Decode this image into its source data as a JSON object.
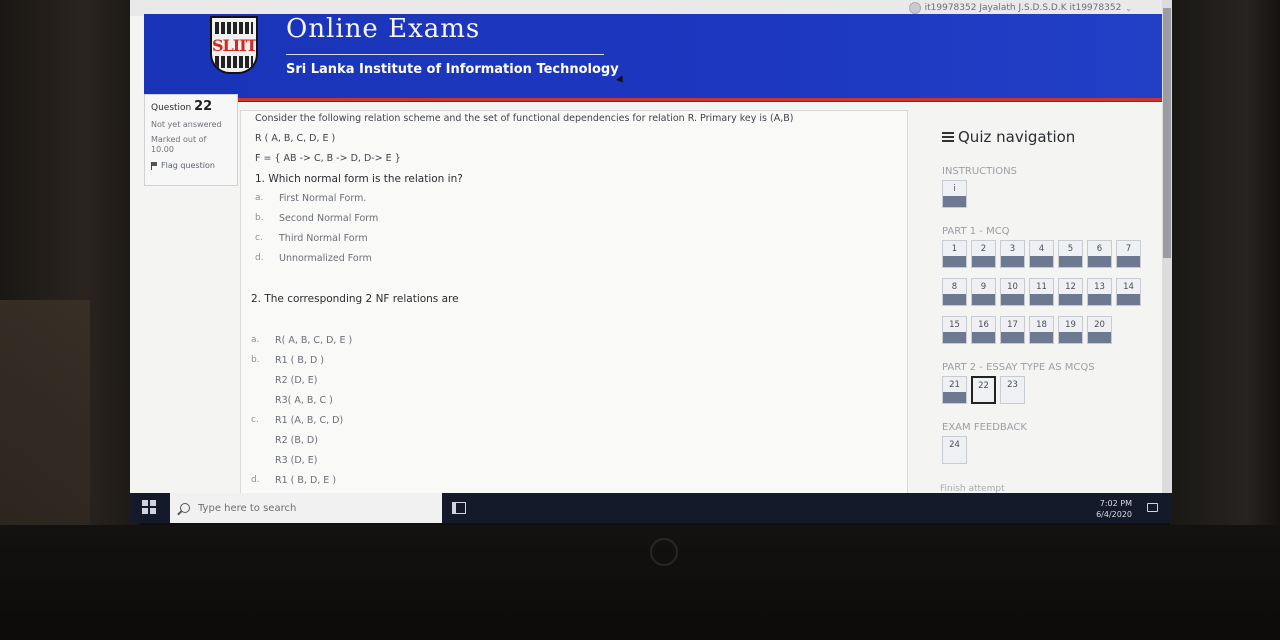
{
  "user": {
    "label": "it19978352 Jayalath J.S.D.S.D.K it19978352"
  },
  "site": {
    "title": "Online Exams",
    "subtitle": "Sri Lanka Institute of Information Technology",
    "logo_text": "SLIIT"
  },
  "question_info": {
    "label": "Question",
    "number": "22",
    "status": "Not yet answered",
    "marks_line1": "Marked out of",
    "marks_line2": "10.00",
    "flag_label": "Flag question"
  },
  "question": {
    "intro": "Consider the following relation scheme and the set of functional dependencies for relation R. Primary key is (A,B)",
    "relation": "R ( A, B, C, D, E )",
    "fds": "F = { AB -> C, B -> D, D-> E }",
    "q1": "1. Which normal form is the relation in?",
    "q1_options": [
      {
        "letter": "a.",
        "text": "First Normal Form."
      },
      {
        "letter": "b.",
        "text": "Second Normal Form"
      },
      {
        "letter": "c.",
        "text": "Third Normal Form"
      },
      {
        "letter": "d.",
        "text": "Unnormalized Form"
      }
    ],
    "q2": "2. The corresponding 2 NF relations are",
    "q2_options": [
      {
        "letter": "a.",
        "lines": [
          "R( A, B, C, D, E )"
        ]
      },
      {
        "letter": "b.",
        "lines": [
          "R1 ( B, D )",
          "R2 (D, E)",
          "R3( A, B, C )"
        ]
      },
      {
        "letter": "c.",
        "lines": [
          "R1 (A, B, C, D)",
          "R2 (B, D)",
          "R3 (D, E)"
        ]
      },
      {
        "letter": "d.",
        "lines": [
          "R1 ( B, D, E )"
        ]
      }
    ]
  },
  "nav": {
    "title": "Quiz navigation",
    "sections": {
      "instructions": "INSTRUCTIONS",
      "part1": "PART 1 - MCQ",
      "part2": "PART 2 - ESSAY TYPE AS MCQS",
      "feedback": "EXAM FEEDBACK"
    },
    "instructions_btn": "i",
    "part1_buttons": [
      "1",
      "2",
      "3",
      "4",
      "5",
      "6",
      "7",
      "8",
      "9",
      "10",
      "11",
      "12",
      "13",
      "14",
      "15",
      "16",
      "17",
      "18",
      "19",
      "20"
    ],
    "part2_buttons": [
      "21",
      "22",
      "23"
    ],
    "feedback_buttons": [
      "24"
    ],
    "current": "22",
    "finish": "Finish attempt"
  },
  "taskbar": {
    "search_placeholder": "Type here to search",
    "time": "7:02 PM",
    "date": "6/4/2020"
  },
  "colors": {
    "header": "#1d37c0",
    "accent_red": "#c9362d",
    "nav_answered": "#6d7891"
  }
}
